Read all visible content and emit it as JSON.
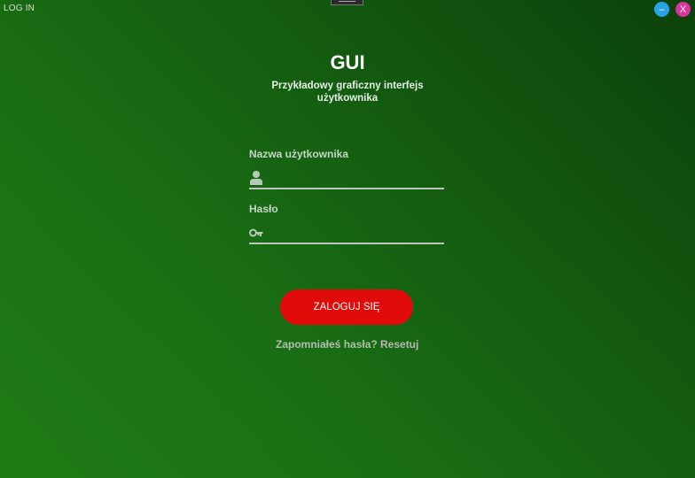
{
  "window": {
    "title": "LOG IN",
    "minimize_label": "–",
    "close_label": "X"
  },
  "header": {
    "title": "GUI",
    "subtitle": "Przykładowy graficzny interfejs użytkownika"
  },
  "form": {
    "username_label": "Nazwa użytkownika",
    "username_icon": "user-icon",
    "username_value": "",
    "password_label": "Hasło",
    "password_icon": "key-icon",
    "password_value": "",
    "login_button_label": "ZALOGUJ SIĘ",
    "forgot_text": "Zapomniałeś hasła?",
    "reset_link": "Resetuj"
  },
  "colors": {
    "background_start": "#1f7a14",
    "background_end": "#0c410b",
    "login_button": "#e20b0b",
    "minimize_button": "#2aa3e6",
    "close_button": "#d9359c"
  }
}
